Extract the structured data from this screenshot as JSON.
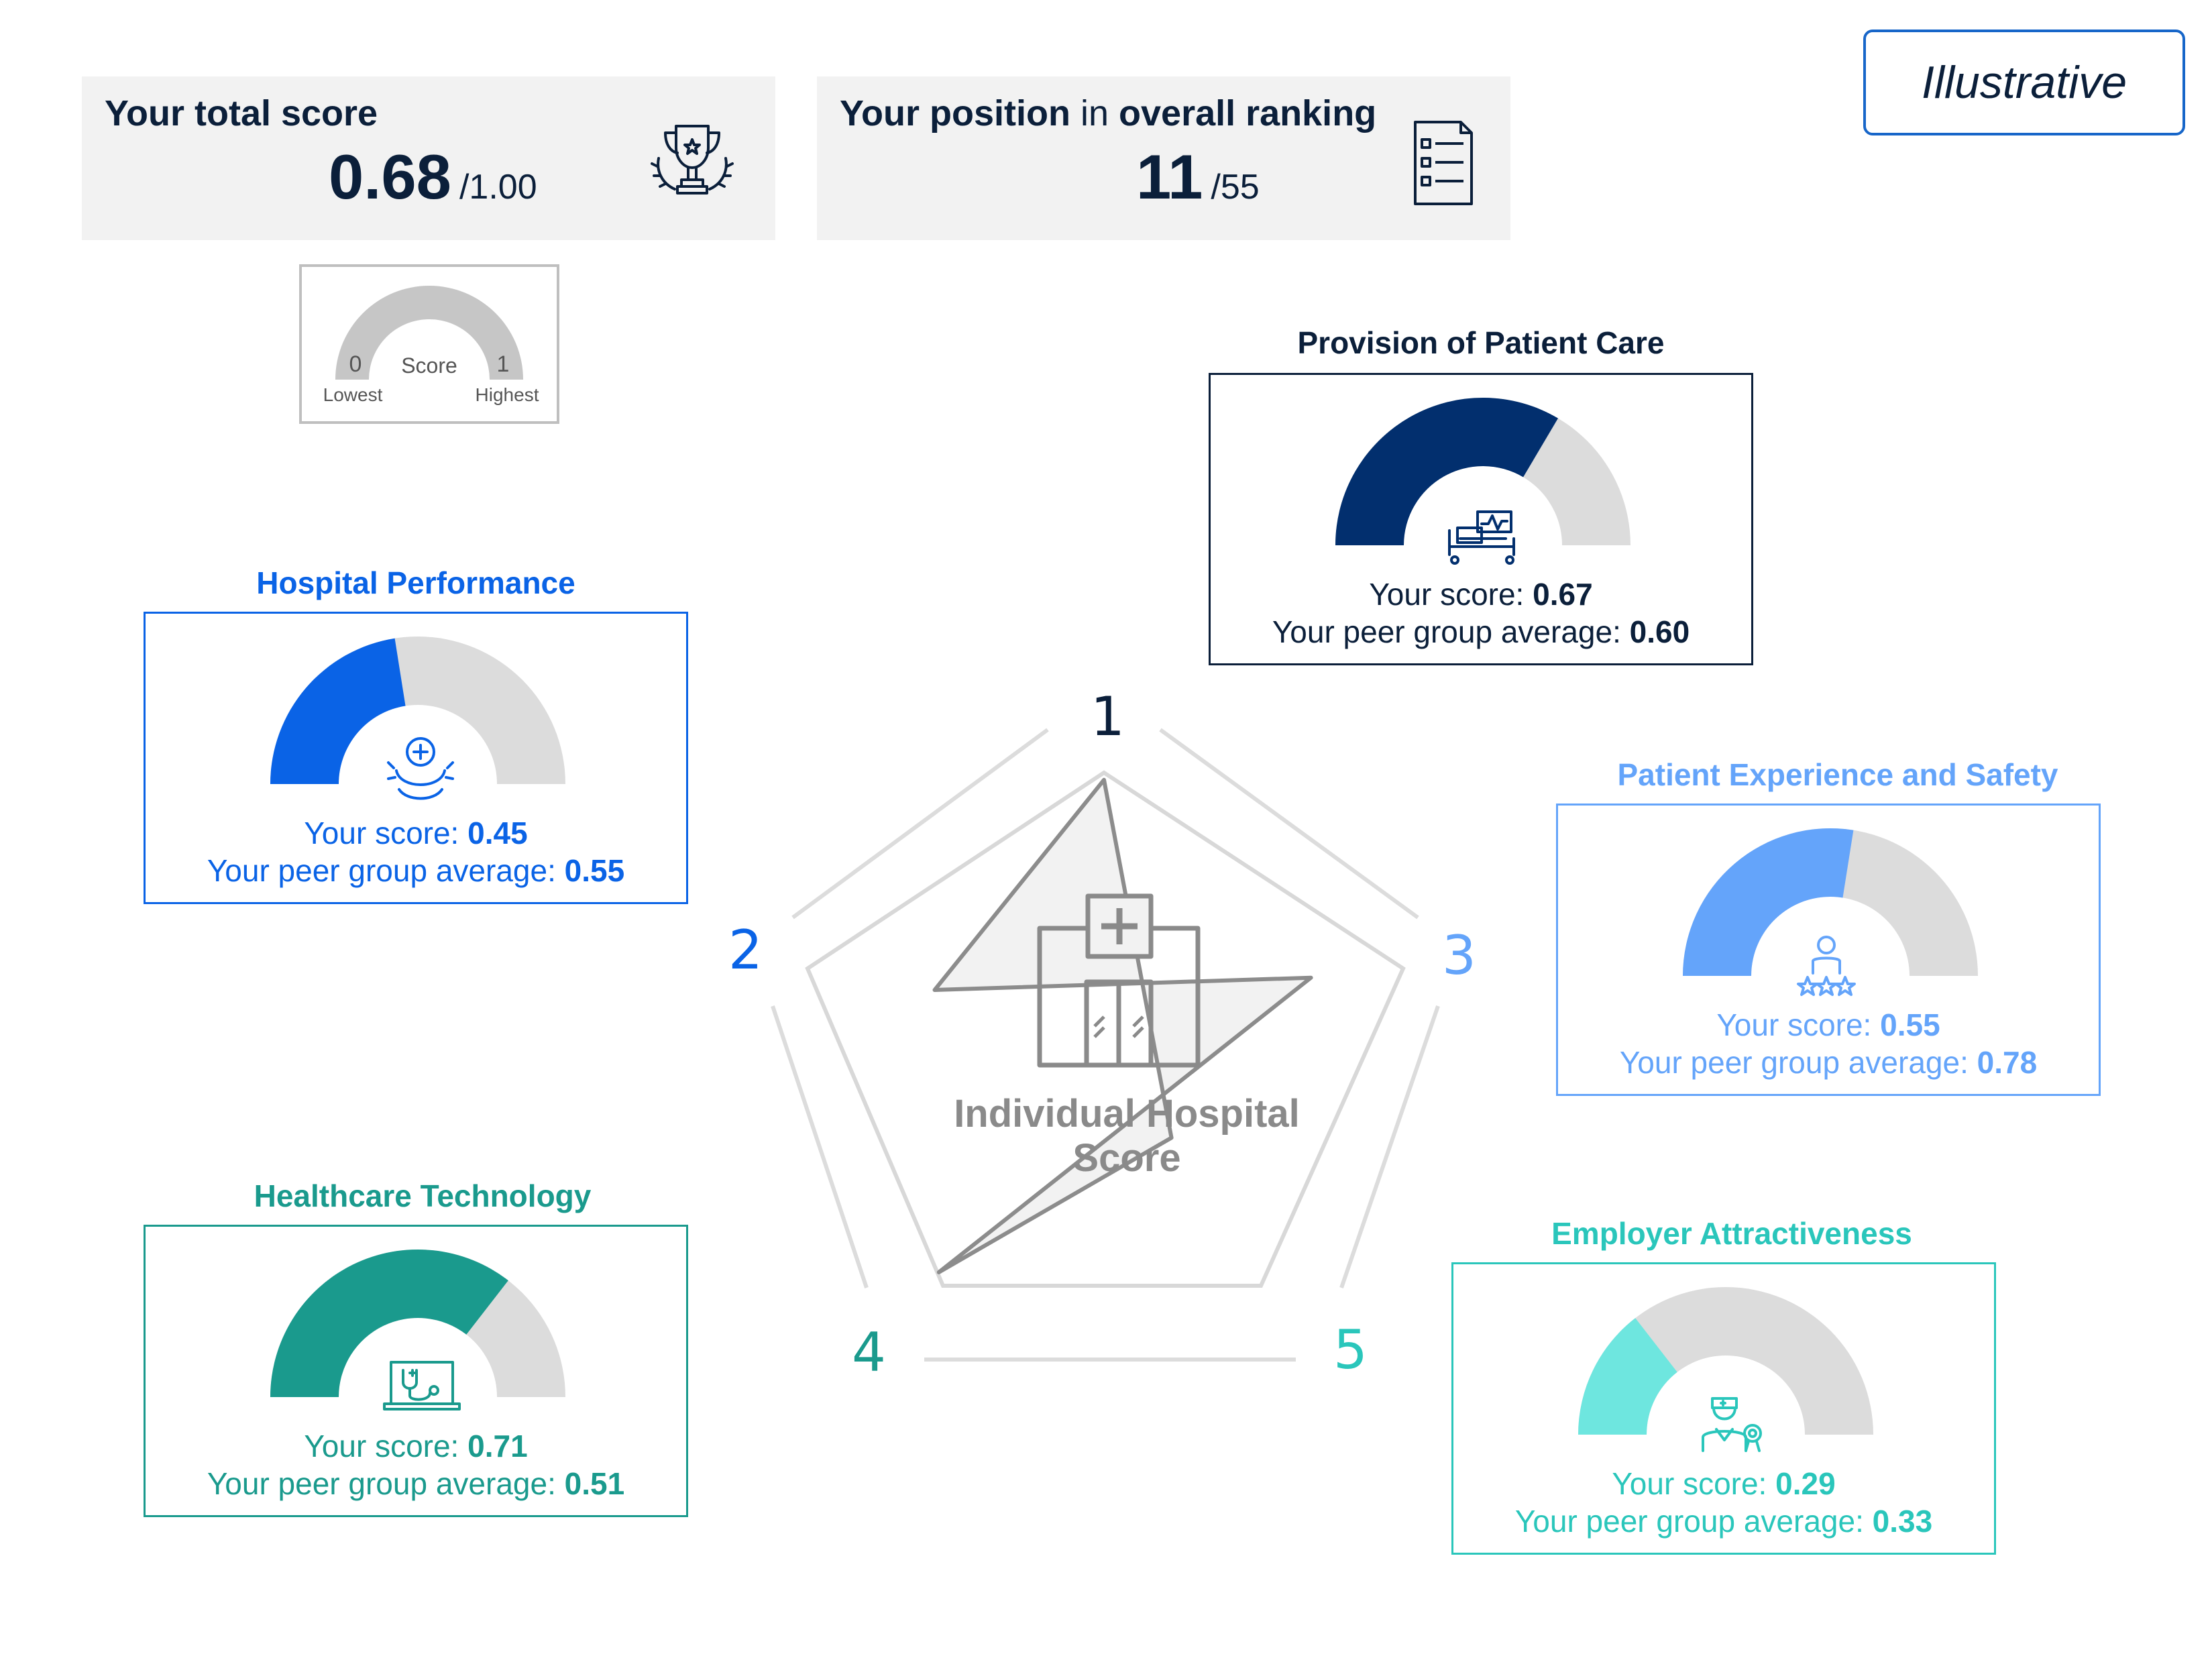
{
  "badge": "Illustrative",
  "total_score": {
    "title": "Your total score",
    "value": "0.68",
    "denominator": "/1.00",
    "icon": "trophy-icon"
  },
  "ranking": {
    "title_bold_1": "Your position",
    "title_light": " in ",
    "title_bold_2": "overall ranking",
    "value": "11",
    "denominator": "/55",
    "icon": "checklist-icon"
  },
  "legend": {
    "min": "0",
    "max": "1",
    "center": "Score",
    "min_label": "Lowest",
    "max_label": "Highest",
    "color": "#c6c6c6"
  },
  "center": {
    "label_line1": "Individual Hospital",
    "label_line2": "Score",
    "icon": "hospital-building-icon"
  },
  "chart_data": {
    "type": "radar",
    "axes": [
      "1",
      "2",
      "3",
      "4",
      "5"
    ],
    "series": [
      {
        "values": [
          0.67,
          0.45,
          0.55,
          0.71,
          0.29
        ]
      }
    ]
  },
  "categories": [
    {
      "id": "provision",
      "number": "1",
      "title": "Provision of Patient Care",
      "score_label": "Your score: ",
      "score": "0.67",
      "peer_label": "Your peer group average: ",
      "peer": "0.60",
      "score_value": 0.67,
      "color": "#022f6e",
      "text_color": "#0b1f3a",
      "icon": "hospital-bed-monitor-icon"
    },
    {
      "id": "performance",
      "number": "2",
      "title": "Hospital Performance",
      "score_label": "Your score: ",
      "score": "0.45",
      "peer_label": "Your peer group average: ",
      "peer": "0.55",
      "score_value": 0.45,
      "color": "#0a63e6",
      "text_color": "#0a63e6",
      "icon": "medical-cross-gear-icon"
    },
    {
      "id": "experience",
      "number": "3",
      "title": "Patient Experience and Safety",
      "score_label": "Your score: ",
      "score": "0.55",
      "peer_label": "Your peer group average: ",
      "peer": "0.78",
      "score_value": 0.55,
      "color": "#64a4fa",
      "text_color": "#64a4fa",
      "icon": "person-stars-icon"
    },
    {
      "id": "technology",
      "number": "4",
      "title": "Healthcare Technology",
      "score_label": "Your score: ",
      "score": "0.71",
      "peer_label": "Your peer group average: ",
      "peer": "0.51",
      "score_value": 0.71,
      "color": "#1a9a8d",
      "text_color": "#1a9a8d",
      "icon": "laptop-stethoscope-icon"
    },
    {
      "id": "employer",
      "number": "5",
      "title": "Employer Attractiveness",
      "score_label": "Your score: ",
      "score": "0.29",
      "peer_label": "Your peer group average: ",
      "peer": "0.33",
      "score_value": 0.29,
      "color": "#6ee6df",
      "text_color": "#2ac6bb",
      "icon": "doctor-badge-icon"
    }
  ]
}
